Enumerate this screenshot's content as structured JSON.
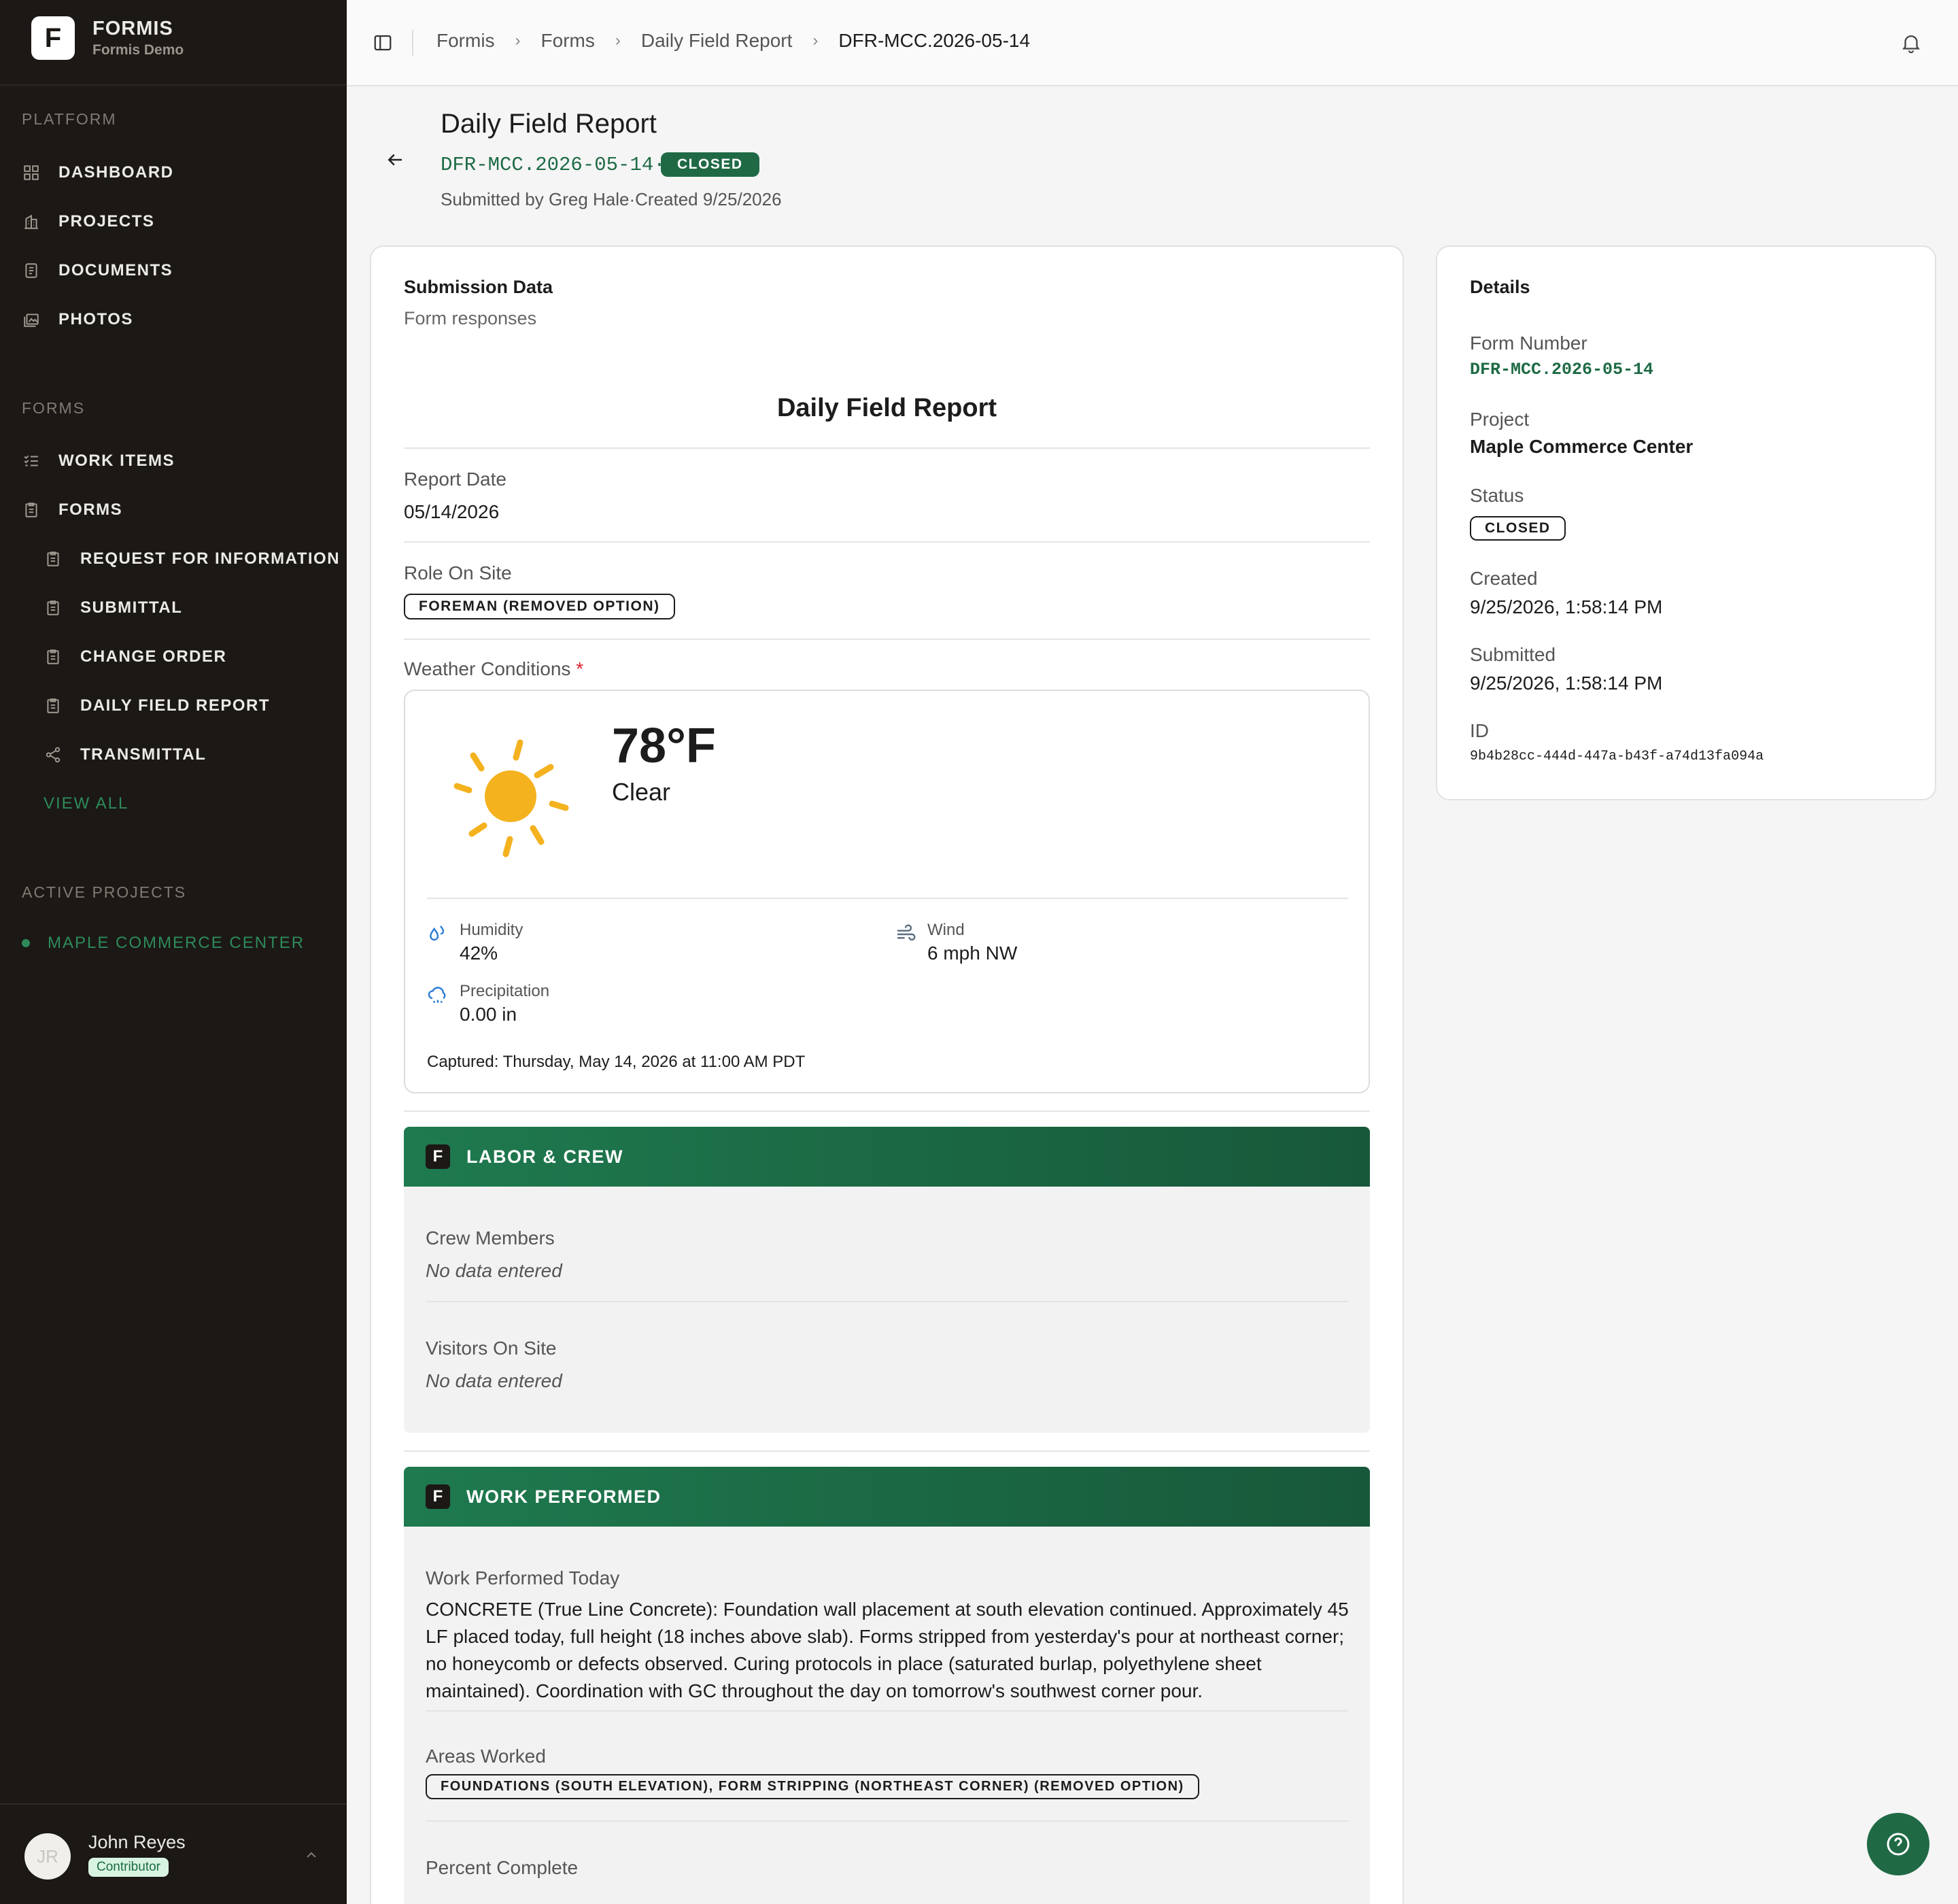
{
  "brand": {
    "name": "FORMIS",
    "subtitle": "Formis Demo",
    "logo_letter": "F"
  },
  "sidebar": {
    "platform_title": "PLATFORM",
    "platform_items": [
      {
        "label": "DASHBOARD",
        "icon": "grid-icon"
      },
      {
        "label": "PROJECTS",
        "icon": "building-icon"
      },
      {
        "label": "DOCUMENTS",
        "icon": "document-icon"
      },
      {
        "label": "PHOTOS",
        "icon": "photos-icon"
      }
    ],
    "forms_title": "FORMS",
    "forms_items": [
      {
        "label": "WORK ITEMS",
        "icon": "checklist-icon"
      },
      {
        "label": "FORMS",
        "icon": "clipboard-icon"
      }
    ],
    "form_types": [
      {
        "label": "REQUEST FOR INFORMATION",
        "icon": "clipboard-icon"
      },
      {
        "label": "SUBMITTAL",
        "icon": "clipboard-icon"
      },
      {
        "label": "CHANGE ORDER",
        "icon": "clipboard-icon"
      },
      {
        "label": "DAILY FIELD REPORT",
        "icon": "clipboard-icon"
      },
      {
        "label": "TRANSMITTAL",
        "icon": "share-icon"
      }
    ],
    "view_all": "VIEW ALL",
    "active_title": "ACTIVE PROJECTS",
    "active_projects": [
      "MAPLE COMMERCE CENTER"
    ]
  },
  "user": {
    "initials": "JR",
    "name": "John Reyes",
    "role": "Contributor"
  },
  "breadcrumb": [
    "Formis",
    "Forms",
    "Daily Field Report",
    "DFR-MCC.2026-05-14"
  ],
  "header": {
    "title": "Daily Field Report",
    "number": "DFR-MCC.2026-05-14",
    "dot": "·",
    "status": "CLOSED",
    "submitted_by": "Submitted by Greg Hale",
    "created": "Created 9/25/2026"
  },
  "submission": {
    "title": "Submission Data",
    "subtitle": "Form responses",
    "form_title": "Daily Field Report",
    "report_date_label": "Report Date",
    "report_date": "05/14/2026",
    "role_label": "Role On Site",
    "role_value": "FOREMAN (REMOVED OPTION)",
    "weather_label": "Weather Conditions",
    "required_mark": "*",
    "weather": {
      "temp": "78°F",
      "condition": "Clear",
      "humidity_label": "Humidity",
      "humidity": "42%",
      "wind_label": "Wind",
      "wind": "6 mph NW",
      "precip_label": "Precipitation",
      "precip": "0.00 in",
      "captured": "Captured: Thursday, May 14, 2026 at 11:00 AM PDT"
    }
  },
  "labor": {
    "title": "LABOR & CREW",
    "crew_label": "Crew Members",
    "crew_value": "No data entered",
    "visitors_label": "Visitors On Site",
    "visitors_value": "No data entered"
  },
  "work": {
    "title": "WORK PERFORMED",
    "today_label": "Work Performed Today",
    "today_value": "CONCRETE (True Line Concrete): Foundation wall placement at south elevation continued. Approximately 45 LF placed today, full height (18 inches above slab). Forms stripped from yesterday's pour at northeast corner; no honeycomb or defects observed. Curing protocols in place (saturated burlap, polyethylene sheet maintained). Coordination with GC throughout the day on tomorrow's southwest corner pour.",
    "areas_label": "Areas Worked",
    "areas_value": "FOUNDATIONS (SOUTH ELEVATION), FORM STRIPPING (NORTHEAST CORNER) (REMOVED OPTION)",
    "percent_label": "Percent Complete"
  },
  "details": {
    "title": "Details",
    "form_number_label": "Form Number",
    "form_number": "DFR-MCC.2026-05-14",
    "project_label": "Project",
    "project": "Maple Commerce Center",
    "status_label": "Status",
    "status": "CLOSED",
    "created_label": "Created",
    "created": "9/25/2026, 1:58:14 PM",
    "submitted_label": "Submitted",
    "submitted": "9/25/2026, 1:58:14 PM",
    "id_label": "ID",
    "id": "9b4b28cc-444d-447a-b43f-a74d13fa094a"
  },
  "colors": {
    "accent": "#1f6a45",
    "sidebar_bg": "#1b1815",
    "sun": "#f4b21f"
  }
}
